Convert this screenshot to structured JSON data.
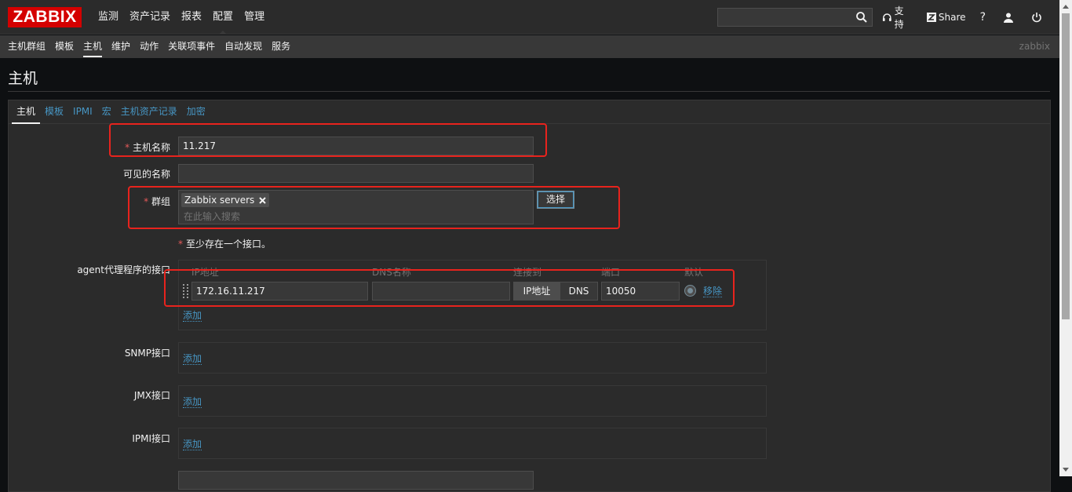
{
  "brand": {
    "logo": "ZABBIX",
    "logo_color": "#d40000"
  },
  "main_nav": [
    {
      "label": "监测",
      "active": false
    },
    {
      "label": "资产记录",
      "active": false
    },
    {
      "label": "报表",
      "active": false
    },
    {
      "label": "配置",
      "active": true
    },
    {
      "label": "管理",
      "active": false
    }
  ],
  "search": {
    "value": "",
    "placeholder": "",
    "icon": "search-icon"
  },
  "top_links": {
    "support_label": "支持",
    "support_icon": "headset-icon",
    "share_label": "Share",
    "share_icon": "zabbix-share-icon",
    "help_icon": "question-icon",
    "user_icon": "user-icon",
    "logout_icon": "power-icon"
  },
  "sub_nav": [
    {
      "label": "主机群组",
      "active": false
    },
    {
      "label": "模板",
      "active": false
    },
    {
      "label": "主机",
      "active": true
    },
    {
      "label": "维护",
      "active": false
    },
    {
      "label": "动作",
      "active": false
    },
    {
      "label": "关联项事件",
      "active": false
    },
    {
      "label": "自动发现",
      "active": false
    },
    {
      "label": "服务",
      "active": false
    }
  ],
  "username": "zabbix",
  "page_title": "主机",
  "tabs": [
    {
      "label": "主机",
      "active": true
    },
    {
      "label": "模板",
      "active": false
    },
    {
      "label": "IPMI",
      "active": false
    },
    {
      "label": "宏",
      "active": false
    },
    {
      "label": "主机资产记录",
      "active": false
    },
    {
      "label": "加密",
      "active": false
    }
  ],
  "form": {
    "host_name_label": "主机名称",
    "host_name_value": "11.217",
    "visible_name_label": "可见的名称",
    "visible_name_value": "",
    "groups_label": "群组",
    "group_chip": "Zabbix servers",
    "groups_placeholder": "在此输入搜索",
    "select_button": "选择",
    "interface_note": "至少存在一个接口。",
    "agent_label": "agent代理程序的接口",
    "columns": {
      "ip": "IP地址",
      "dns": "DNS名称",
      "connect": "连接到",
      "port": "端口",
      "default": "默认"
    },
    "agent_interface": {
      "ip": "172.16.11.217",
      "dns": "",
      "connect_ip": "IP地址",
      "connect_dns": "DNS",
      "port": "10050",
      "remove": "移除"
    },
    "add_link": "添加",
    "snmp_label": "SNMP接口",
    "jmx_label": "JMX接口",
    "ipmi_label": "IPMI接口"
  },
  "colors": {
    "accent_link": "#4796c4",
    "highlight_box": "#e8231d",
    "required_star": "#e45959"
  }
}
